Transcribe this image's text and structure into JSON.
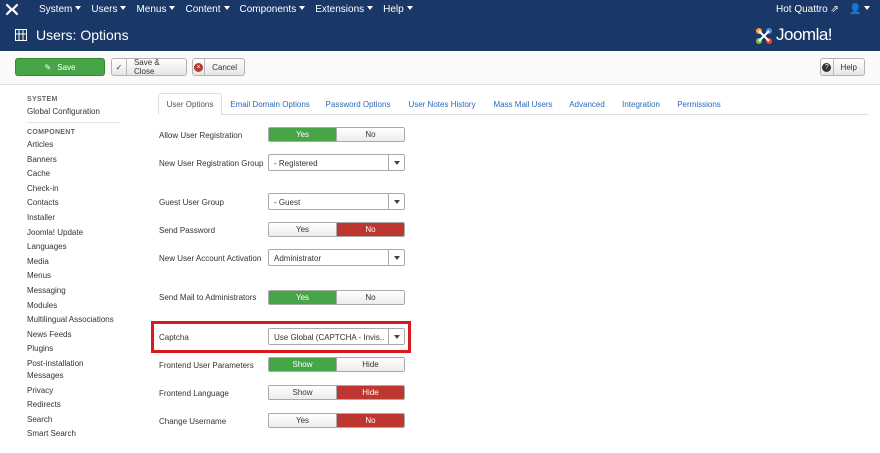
{
  "topnav": {
    "menu": [
      "System",
      "Users",
      "Menus",
      "Content",
      "Components",
      "Extensions",
      "Help"
    ],
    "site_name": "Hot Quattro",
    "user_icon": "user-icon"
  },
  "titlebar": {
    "title": "Users: Options",
    "brand": "Joomla!"
  },
  "toolbar": {
    "save": "Save",
    "save_close": "Save & Close",
    "cancel": "Cancel",
    "help": "Help"
  },
  "sidebar": {
    "system_heading": "SYSTEM",
    "system_items": [
      "Global Configuration"
    ],
    "component_heading": "COMPONENT",
    "component_items": [
      "Articles",
      "Banners",
      "Cache",
      "Check-in",
      "Contacts",
      "Installer",
      "Joomla! Update",
      "Languages",
      "Media",
      "Menus",
      "Messaging",
      "Modules",
      "Multilingual Associations",
      "News Feeds",
      "Plugins",
      "Post-installation Messages",
      "Privacy",
      "Redirects",
      "Search",
      "Smart Search"
    ]
  },
  "tabs": [
    "User Options",
    "Email Domain Options",
    "Password Options",
    "User Notes History",
    "Mass Mail Users",
    "Advanced",
    "Integration",
    "Permissions"
  ],
  "form": {
    "allow_reg": {
      "label": "Allow User Registration",
      "on": "Yes",
      "off": "No"
    },
    "new_reg_group": {
      "label": "New User Registration Group",
      "value": "- Registered"
    },
    "guest_group": {
      "label": "Guest User Group",
      "value": "- Guest"
    },
    "send_password": {
      "label": "Send Password",
      "on": "Yes",
      "off": "No"
    },
    "activation": {
      "label": "New User Account Activation",
      "value": "Administrator"
    },
    "send_mail": {
      "label": "Send Mail to Administrators",
      "on": "Yes",
      "off": "No"
    },
    "captcha": {
      "label": "Captcha",
      "value": "Use Global (CAPTCHA - Invis..."
    },
    "frontend_params": {
      "label": "Frontend User Parameters",
      "on": "Show",
      "off": "Hide"
    },
    "frontend_lang": {
      "label": "Frontend Language",
      "on": "Show",
      "off": "Hide"
    },
    "change_username": {
      "label": "Change Username",
      "on": "Yes",
      "off": "No"
    }
  },
  "colors": {
    "nav_bg": "#1a3867",
    "green": "#46a546",
    "red": "#bd362f",
    "highlight": "#d9191c",
    "link": "#2a69b8"
  }
}
